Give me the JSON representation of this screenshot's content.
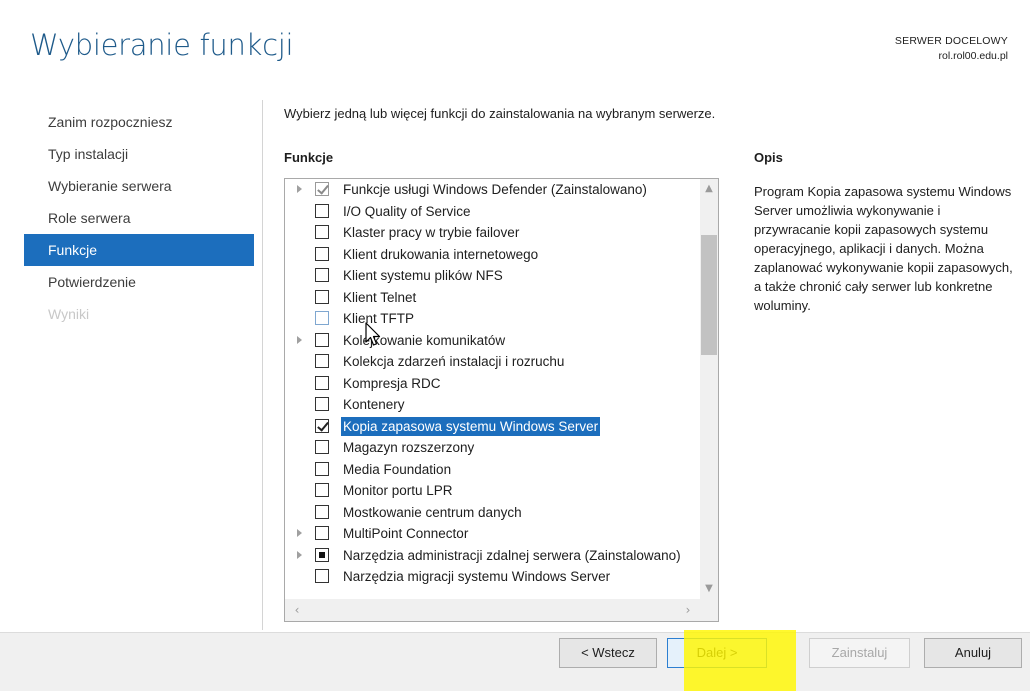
{
  "header": {
    "title": "Wybieranie funkcji",
    "target_label": "SERWER DOCELOWY",
    "target_server": "rol.rol00.edu.pl"
  },
  "nav": {
    "items": [
      {
        "label": "Zanim rozpoczniesz",
        "state": "normal"
      },
      {
        "label": "Typ instalacji",
        "state": "normal"
      },
      {
        "label": "Wybieranie serwera",
        "state": "normal"
      },
      {
        "label": "Role serwera",
        "state": "normal"
      },
      {
        "label": "Funkcje",
        "state": "active"
      },
      {
        "label": "Potwierdzenie",
        "state": "normal"
      },
      {
        "label": "Wyniki",
        "state": "disabled"
      }
    ]
  },
  "main": {
    "instruction": "Wybierz jedną lub więcej funkcji do zainstalowania na wybranym serwerze.",
    "features_heading": "Funkcje",
    "description_heading": "Opis",
    "description": "Program Kopia zapasowa systemu Windows Server umożliwia wykonywanie i przywracanie kopii zapasowych systemu operacyjnego, aplikacji i danych. Można zaplanować wykonywanie kopii zapasowych, a także chronić cały serwer lub konkretne woluminy."
  },
  "features": [
    {
      "label": "Funkcje usługi Windows Defender (Zainstalowano)",
      "expandable": true,
      "check": "checked-grey",
      "selected": false
    },
    {
      "label": "I/O Quality of Service",
      "expandable": false,
      "check": "none",
      "selected": false
    },
    {
      "label": "Klaster pracy w trybie failover",
      "expandable": false,
      "check": "none",
      "selected": false
    },
    {
      "label": "Klient drukowania internetowego",
      "expandable": false,
      "check": "none",
      "selected": false
    },
    {
      "label": "Klient systemu plików NFS",
      "expandable": false,
      "check": "none",
      "selected": false
    },
    {
      "label": "Klient Telnet",
      "expandable": false,
      "check": "none",
      "selected": false
    },
    {
      "label": "Klient TFTP",
      "expandable": false,
      "check": "hover",
      "selected": false
    },
    {
      "label": "Kolejkowanie komunikatów",
      "expandable": true,
      "check": "none",
      "selected": false
    },
    {
      "label": "Kolekcja zdarzeń instalacji i rozruchu",
      "expandable": false,
      "check": "none",
      "selected": false
    },
    {
      "label": "Kompresja RDC",
      "expandable": false,
      "check": "none",
      "selected": false
    },
    {
      "label": "Kontenery",
      "expandable": false,
      "check": "none",
      "selected": false
    },
    {
      "label": "Kopia zapasowa systemu Windows Server",
      "expandable": false,
      "check": "checked",
      "selected": true
    },
    {
      "label": "Magazyn rozszerzony",
      "expandable": false,
      "check": "none",
      "selected": false
    },
    {
      "label": "Media Foundation",
      "expandable": false,
      "check": "none",
      "selected": false
    },
    {
      "label": "Monitor portu LPR",
      "expandable": false,
      "check": "none",
      "selected": false
    },
    {
      "label": "Mostkowanie centrum danych",
      "expandable": false,
      "check": "none",
      "selected": false
    },
    {
      "label": "MultiPoint Connector",
      "expandable": true,
      "check": "none",
      "selected": false
    },
    {
      "label": "Narzędzia administracji zdalnej serwera (Zainstalowano)",
      "expandable": true,
      "check": "partial",
      "selected": false
    },
    {
      "label": "Narzędzia migracji systemu Windows Server",
      "expandable": false,
      "check": "none",
      "selected": false
    }
  ],
  "buttons": {
    "back": "< Wstecz",
    "next": "Dalej >",
    "install": "Zainstaluj",
    "cancel": "Anuluj"
  },
  "colors": {
    "accent": "#1c6ebd",
    "title": "#1e5a8a",
    "highlight": "#fff600"
  }
}
